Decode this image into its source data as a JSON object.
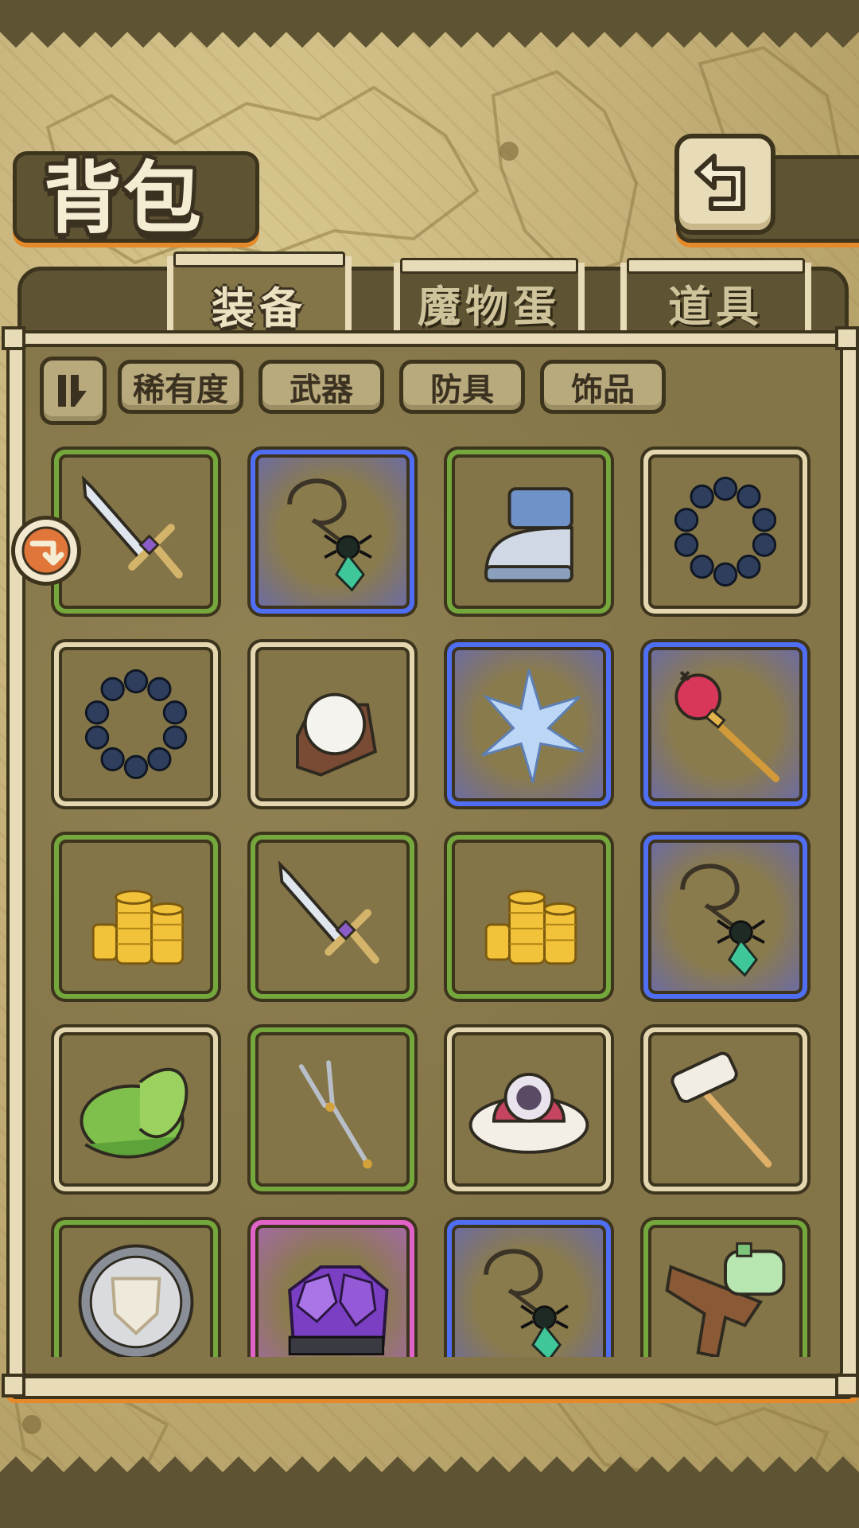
{
  "screen": {
    "title": "背包"
  },
  "header": {
    "back_icon": "return-arrow-icon"
  },
  "tabs": [
    {
      "label": "装备",
      "active": true
    },
    {
      "label": "魔物蛋",
      "active": false
    },
    {
      "label": "道具",
      "active": false
    }
  ],
  "filters": {
    "sort_icon": "sort-toggle-icon",
    "buttons": [
      "稀有度",
      "武器",
      "防具",
      "饰品"
    ]
  },
  "rarity_colors": {
    "common": "#e4d6ae",
    "green": "#75a83c",
    "blue": "#4f6ef2",
    "pink": "#e163c8"
  },
  "items": [
    {
      "name": "sword-icon",
      "rarity": "green"
    },
    {
      "name": "spider-necklace-icon",
      "rarity": "blue"
    },
    {
      "name": "iron-boot-icon",
      "rarity": "green"
    },
    {
      "name": "bead-bracelet-icon",
      "rarity": "common"
    },
    {
      "name": "bead-bracelet-icon",
      "rarity": "common"
    },
    {
      "name": "white-gem-ring-icon",
      "rarity": "common"
    },
    {
      "name": "ice-crystal-icon",
      "rarity": "blue"
    },
    {
      "name": "ruby-scepter-icon",
      "rarity": "blue"
    },
    {
      "name": "gold-coins-icon",
      "rarity": "green"
    },
    {
      "name": "sword-icon",
      "rarity": "green"
    },
    {
      "name": "gold-coins-icon",
      "rarity": "green"
    },
    {
      "name": "spider-necklace-icon",
      "rarity": "blue"
    },
    {
      "name": "leaf-hat-icon",
      "rarity": "common"
    },
    {
      "name": "tuning-fork-icon",
      "rarity": "green"
    },
    {
      "name": "eyeball-hat-icon",
      "rarity": "common"
    },
    {
      "name": "brush-icon",
      "rarity": "common"
    },
    {
      "name": "round-shield-icon",
      "rarity": "green"
    },
    {
      "name": "amethyst-armor-icon",
      "rarity": "pink"
    },
    {
      "name": "spider-necklace-icon",
      "rarity": "blue"
    },
    {
      "name": "water-gun-icon",
      "rarity": "green"
    }
  ],
  "side_badge_icon": "scroll-arrow-icon"
}
